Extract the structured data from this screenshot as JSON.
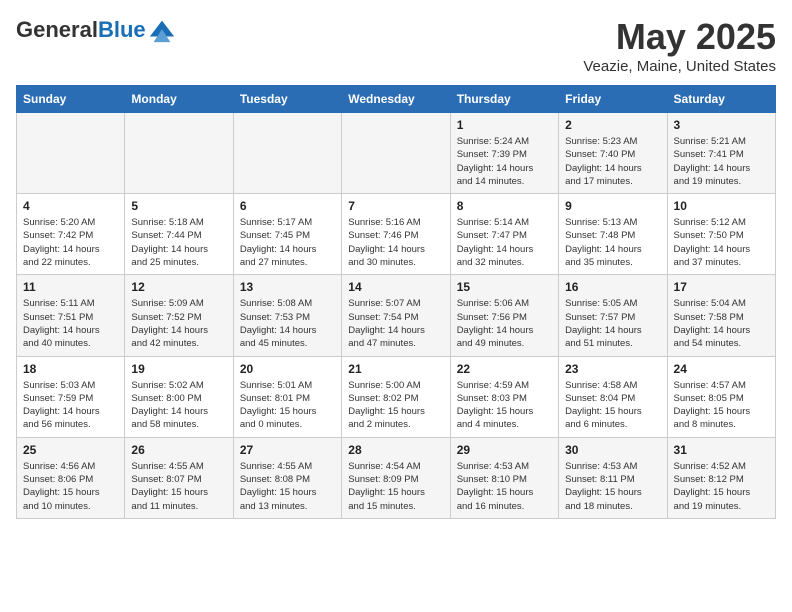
{
  "header": {
    "logo_line1": "General",
    "logo_line2": "Blue",
    "month": "May 2025",
    "location": "Veazie, Maine, United States"
  },
  "weekdays": [
    "Sunday",
    "Monday",
    "Tuesday",
    "Wednesday",
    "Thursday",
    "Friday",
    "Saturday"
  ],
  "weeks": [
    [
      {
        "day": "",
        "info": ""
      },
      {
        "day": "",
        "info": ""
      },
      {
        "day": "",
        "info": ""
      },
      {
        "day": "",
        "info": ""
      },
      {
        "day": "1",
        "info": "Sunrise: 5:24 AM\nSunset: 7:39 PM\nDaylight: 14 hours\nand 14 minutes."
      },
      {
        "day": "2",
        "info": "Sunrise: 5:23 AM\nSunset: 7:40 PM\nDaylight: 14 hours\nand 17 minutes."
      },
      {
        "day": "3",
        "info": "Sunrise: 5:21 AM\nSunset: 7:41 PM\nDaylight: 14 hours\nand 19 minutes."
      }
    ],
    [
      {
        "day": "4",
        "info": "Sunrise: 5:20 AM\nSunset: 7:42 PM\nDaylight: 14 hours\nand 22 minutes."
      },
      {
        "day": "5",
        "info": "Sunrise: 5:18 AM\nSunset: 7:44 PM\nDaylight: 14 hours\nand 25 minutes."
      },
      {
        "day": "6",
        "info": "Sunrise: 5:17 AM\nSunset: 7:45 PM\nDaylight: 14 hours\nand 27 minutes."
      },
      {
        "day": "7",
        "info": "Sunrise: 5:16 AM\nSunset: 7:46 PM\nDaylight: 14 hours\nand 30 minutes."
      },
      {
        "day": "8",
        "info": "Sunrise: 5:14 AM\nSunset: 7:47 PM\nDaylight: 14 hours\nand 32 minutes."
      },
      {
        "day": "9",
        "info": "Sunrise: 5:13 AM\nSunset: 7:48 PM\nDaylight: 14 hours\nand 35 minutes."
      },
      {
        "day": "10",
        "info": "Sunrise: 5:12 AM\nSunset: 7:50 PM\nDaylight: 14 hours\nand 37 minutes."
      }
    ],
    [
      {
        "day": "11",
        "info": "Sunrise: 5:11 AM\nSunset: 7:51 PM\nDaylight: 14 hours\nand 40 minutes."
      },
      {
        "day": "12",
        "info": "Sunrise: 5:09 AM\nSunset: 7:52 PM\nDaylight: 14 hours\nand 42 minutes."
      },
      {
        "day": "13",
        "info": "Sunrise: 5:08 AM\nSunset: 7:53 PM\nDaylight: 14 hours\nand 45 minutes."
      },
      {
        "day": "14",
        "info": "Sunrise: 5:07 AM\nSunset: 7:54 PM\nDaylight: 14 hours\nand 47 minutes."
      },
      {
        "day": "15",
        "info": "Sunrise: 5:06 AM\nSunset: 7:56 PM\nDaylight: 14 hours\nand 49 minutes."
      },
      {
        "day": "16",
        "info": "Sunrise: 5:05 AM\nSunset: 7:57 PM\nDaylight: 14 hours\nand 51 minutes."
      },
      {
        "day": "17",
        "info": "Sunrise: 5:04 AM\nSunset: 7:58 PM\nDaylight: 14 hours\nand 54 minutes."
      }
    ],
    [
      {
        "day": "18",
        "info": "Sunrise: 5:03 AM\nSunset: 7:59 PM\nDaylight: 14 hours\nand 56 minutes."
      },
      {
        "day": "19",
        "info": "Sunrise: 5:02 AM\nSunset: 8:00 PM\nDaylight: 14 hours\nand 58 minutes."
      },
      {
        "day": "20",
        "info": "Sunrise: 5:01 AM\nSunset: 8:01 PM\nDaylight: 15 hours\nand 0 minutes."
      },
      {
        "day": "21",
        "info": "Sunrise: 5:00 AM\nSunset: 8:02 PM\nDaylight: 15 hours\nand 2 minutes."
      },
      {
        "day": "22",
        "info": "Sunrise: 4:59 AM\nSunset: 8:03 PM\nDaylight: 15 hours\nand 4 minutes."
      },
      {
        "day": "23",
        "info": "Sunrise: 4:58 AM\nSunset: 8:04 PM\nDaylight: 15 hours\nand 6 minutes."
      },
      {
        "day": "24",
        "info": "Sunrise: 4:57 AM\nSunset: 8:05 PM\nDaylight: 15 hours\nand 8 minutes."
      }
    ],
    [
      {
        "day": "25",
        "info": "Sunrise: 4:56 AM\nSunset: 8:06 PM\nDaylight: 15 hours\nand 10 minutes."
      },
      {
        "day": "26",
        "info": "Sunrise: 4:55 AM\nSunset: 8:07 PM\nDaylight: 15 hours\nand 11 minutes."
      },
      {
        "day": "27",
        "info": "Sunrise: 4:55 AM\nSunset: 8:08 PM\nDaylight: 15 hours\nand 13 minutes."
      },
      {
        "day": "28",
        "info": "Sunrise: 4:54 AM\nSunset: 8:09 PM\nDaylight: 15 hours\nand 15 minutes."
      },
      {
        "day": "29",
        "info": "Sunrise: 4:53 AM\nSunset: 8:10 PM\nDaylight: 15 hours\nand 16 minutes."
      },
      {
        "day": "30",
        "info": "Sunrise: 4:53 AM\nSunset: 8:11 PM\nDaylight: 15 hours\nand 18 minutes."
      },
      {
        "day": "31",
        "info": "Sunrise: 4:52 AM\nSunset: 8:12 PM\nDaylight: 15 hours\nand 19 minutes."
      }
    ]
  ]
}
